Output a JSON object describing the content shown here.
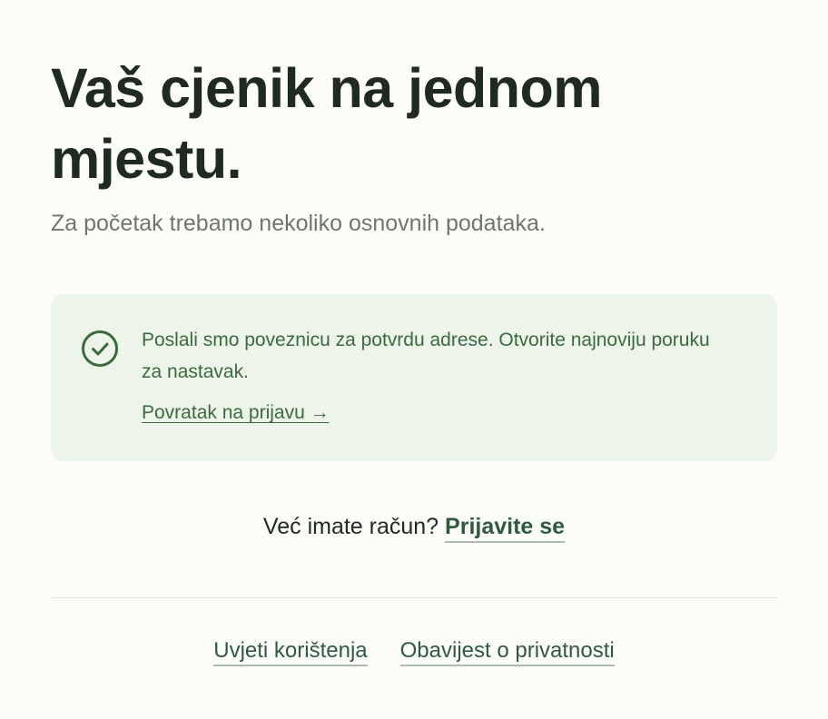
{
  "header": {
    "title": "Vaš cjenik na jednom mjestu.",
    "subtitle": "Za početak trebamo nekoliko osnovnih podataka."
  },
  "notice": {
    "icon": "check-circle-icon",
    "message": "Poslali smo poveznicu za potvrdu adrese. Otvorite najnoviju poruku za nastavak.",
    "back_link": "Povratak na prijavu →"
  },
  "account": {
    "prompt": "Već imate račun?",
    "signin_link": "Prijavite se"
  },
  "footer": {
    "terms_link": "Uvjeti korištenja",
    "privacy_link": "Obavijest o privatnosti"
  },
  "colors": {
    "background": "#fcfcf8",
    "notice_background": "#edf4ea",
    "accent_green": "#3b6a3c",
    "link_green": "#2f5a3e",
    "text_dark": "#1f2a23",
    "text_muted": "#6f7670"
  }
}
